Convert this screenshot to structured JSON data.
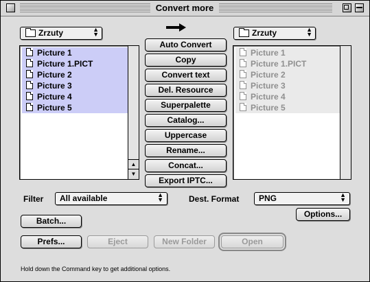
{
  "window": {
    "title": "Convert more"
  },
  "source": {
    "folder": "Zrzuty",
    "files": [
      "Picture 1",
      "Picture 1.PICT",
      "Picture 2",
      "Picture 3",
      "Picture 4",
      "Picture 5"
    ]
  },
  "destination": {
    "folder": "Zrzuty",
    "files": [
      "Picture 1",
      "Picture 1.PICT",
      "Picture 2",
      "Picture 3",
      "Picture 4",
      "Picture 5"
    ]
  },
  "actions": [
    "Auto Convert",
    "Copy",
    "Convert text",
    "Del. Resource",
    "Superpalette",
    "Catalog...",
    "Uppercase",
    "Rename...",
    "Concat...",
    "Export IPTC..."
  ],
  "filter": {
    "label": "Filter",
    "value": "All available"
  },
  "dest_format": {
    "label": "Dest. Format",
    "value": "PNG"
  },
  "buttons": {
    "options": "Options...",
    "batch": "Batch...",
    "prefs": "Prefs...",
    "eject": "Eject",
    "new_folder": "New Folder",
    "open": "Open"
  },
  "hint": "Hold down the Command key to get additional options.",
  "colors": {
    "selection": "#cccdf7",
    "window": "#dddddd",
    "desktop": "#1f3b6e"
  }
}
